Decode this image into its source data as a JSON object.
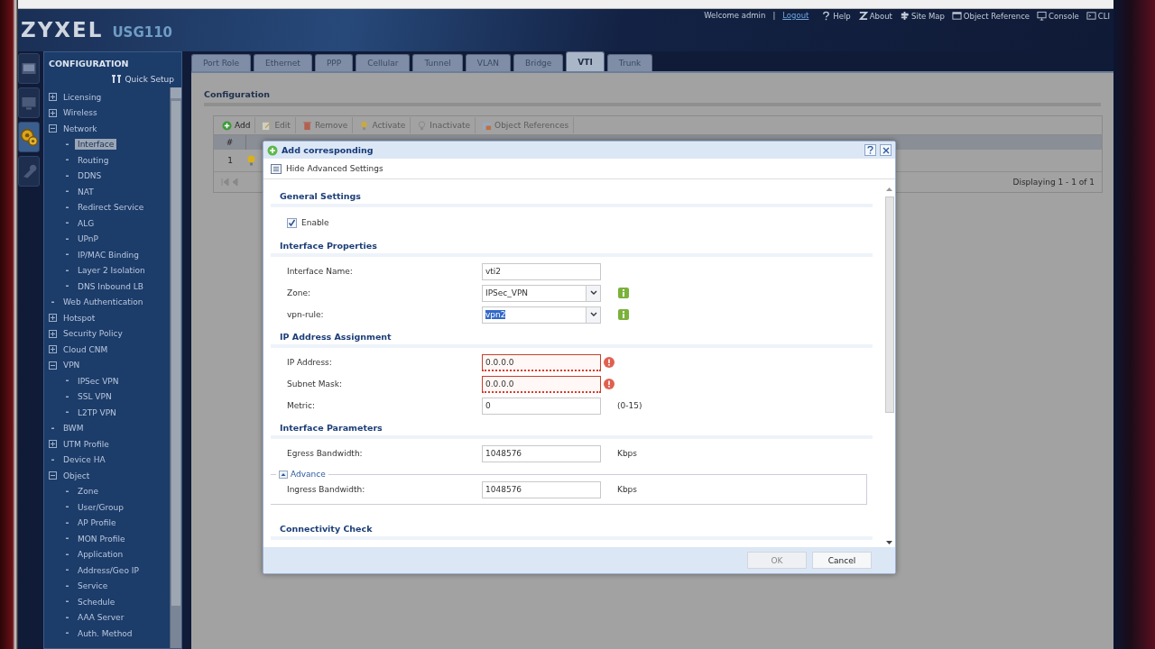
{
  "header": {
    "brand": "ZYXEL",
    "model": "USG110",
    "welcome": "Welcome admin",
    "separator": "|",
    "logout": "Logout",
    "links": [
      {
        "kind": "help",
        "label": "Help"
      },
      {
        "kind": "about",
        "label": "About"
      },
      {
        "kind": "sitemap",
        "label": "Site Map"
      },
      {
        "kind": "reference",
        "label": "Object Reference"
      },
      {
        "kind": "console",
        "label": "Console"
      },
      {
        "kind": "cli",
        "label": "CLI"
      }
    ]
  },
  "rail": [
    {
      "kind": "dashboard",
      "selected": false
    },
    {
      "kind": "monitor",
      "selected": false
    },
    {
      "kind": "configuration",
      "selected": true
    },
    {
      "kind": "maintenance",
      "selected": false
    }
  ],
  "sidebar": {
    "title": "CONFIGURATION",
    "quick_setup": "Quick Setup",
    "items": [
      {
        "label": "Licensing",
        "kind": "group",
        "expanded": false,
        "selected": false
      },
      {
        "label": "Wireless",
        "kind": "group",
        "expanded": false,
        "selected": false
      },
      {
        "label": "Network",
        "kind": "group",
        "expanded": true,
        "selected": false,
        "children": [
          {
            "label": "Interface",
            "kind": "leaf",
            "selected": true
          },
          {
            "label": "Routing",
            "kind": "leaf",
            "selected": false
          },
          {
            "label": "DDNS",
            "kind": "leaf",
            "selected": false
          },
          {
            "label": "NAT",
            "kind": "leaf",
            "selected": false
          },
          {
            "label": "Redirect Service",
            "kind": "leaf",
            "selected": false
          },
          {
            "label": "ALG",
            "kind": "leaf",
            "selected": false
          },
          {
            "label": "UPnP",
            "kind": "leaf",
            "selected": false
          },
          {
            "label": "IP/MAC Binding",
            "kind": "leaf",
            "selected": false
          },
          {
            "label": "Layer 2 Isolation",
            "kind": "leaf",
            "selected": false
          },
          {
            "label": "DNS Inbound LB",
            "kind": "leaf",
            "selected": false
          }
        ]
      },
      {
        "label": "Web Authentication",
        "kind": "leaf",
        "selected": false
      },
      {
        "label": "Hotspot",
        "kind": "group",
        "expanded": false,
        "selected": false
      },
      {
        "label": "Security Policy",
        "kind": "group",
        "expanded": false,
        "selected": false
      },
      {
        "label": "Cloud CNM",
        "kind": "group",
        "expanded": false,
        "selected": false
      },
      {
        "label": "VPN",
        "kind": "group",
        "expanded": true,
        "selected": false,
        "children": [
          {
            "label": "IPSec VPN",
            "kind": "leaf",
            "selected": false
          },
          {
            "label": "SSL VPN",
            "kind": "leaf",
            "selected": false
          },
          {
            "label": "L2TP VPN",
            "kind": "leaf",
            "selected": false
          }
        ]
      },
      {
        "label": "BWM",
        "kind": "leaf",
        "selected": false
      },
      {
        "label": "UTM Profile",
        "kind": "group",
        "expanded": false,
        "selected": false
      },
      {
        "label": "Device HA",
        "kind": "leaf",
        "selected": false
      },
      {
        "label": "Object",
        "kind": "group",
        "expanded": true,
        "selected": false,
        "children": [
          {
            "label": "Zone",
            "kind": "leaf",
            "selected": false
          },
          {
            "label": "User/Group",
            "kind": "leaf",
            "selected": false
          },
          {
            "label": "AP Profile",
            "kind": "leaf",
            "selected": false
          },
          {
            "label": "MON Profile",
            "kind": "leaf",
            "selected": false
          },
          {
            "label": "Application",
            "kind": "leaf",
            "selected": false
          },
          {
            "label": "Address/Geo IP",
            "kind": "leaf",
            "selected": false
          },
          {
            "label": "Service",
            "kind": "leaf",
            "selected": false
          },
          {
            "label": "Schedule",
            "kind": "leaf",
            "selected": false
          },
          {
            "label": "AAA Server",
            "kind": "leaf",
            "selected": false
          },
          {
            "label": "Auth. Method",
            "kind": "leaf",
            "selected": false
          }
        ]
      }
    ]
  },
  "tabs": [
    {
      "label": "Port Role",
      "selected": false
    },
    {
      "label": "Ethernet",
      "selected": false
    },
    {
      "label": "PPP",
      "selected": false
    },
    {
      "label": "Cellular",
      "selected": false
    },
    {
      "label": "Tunnel",
      "selected": false
    },
    {
      "label": "VLAN",
      "selected": false
    },
    {
      "label": "Bridge",
      "selected": false
    },
    {
      "label": "VTI",
      "selected": true
    },
    {
      "label": "Trunk",
      "selected": false
    }
  ],
  "panel": {
    "title": "Configuration",
    "toolbar": [
      {
        "kind": "add",
        "label": "Add",
        "disabled": false
      },
      {
        "kind": "edit",
        "label": "Edit",
        "disabled": true
      },
      {
        "kind": "remove",
        "label": "Remove",
        "disabled": true
      },
      {
        "kind": "activate",
        "label": "Activate",
        "disabled": true
      },
      {
        "kind": "inactivate",
        "label": "Inactivate",
        "disabled": true
      },
      {
        "kind": "references",
        "label": "Object References",
        "disabled": true
      }
    ],
    "table": {
      "columns": [
        "#"
      ],
      "rows": [
        {
          "cells": [
            "1"
          ],
          "active": true
        }
      ]
    },
    "pager": "Displaying 1 - 1 of 1"
  },
  "dialog": {
    "title": "Add corresponding",
    "toggle": "Hide Advanced Settings",
    "sections": [
      {
        "title": "General Settings",
        "rows": [
          {
            "kind": "checkbox",
            "label": "Enable",
            "checked": true
          }
        ]
      },
      {
        "title": "Interface Properties",
        "rows": [
          {
            "kind": "text",
            "label": "Interface Name:",
            "value": "vti2",
            "invalid": false
          },
          {
            "kind": "select",
            "label": "Zone:",
            "value": "IPSec_VPN",
            "info": true,
            "text_selected": false
          },
          {
            "kind": "select",
            "label": "vpn-rule:",
            "value": "vpn2",
            "info": true,
            "text_selected": true
          }
        ]
      },
      {
        "title": "IP Address Assignment",
        "rows": [
          {
            "kind": "text",
            "label": "IP Address:",
            "value": "0.0.0.0",
            "invalid": true
          },
          {
            "kind": "text",
            "label": "Subnet Mask:",
            "value": "0.0.0.0",
            "invalid": true
          },
          {
            "kind": "text",
            "label": "Metric:",
            "value": "0",
            "invalid": false,
            "suffix": "(0-15)"
          }
        ]
      },
      {
        "title": "Interface Parameters",
        "rows": [
          {
            "kind": "text",
            "label": "Egress Bandwidth:",
            "value": "1048576",
            "invalid": false,
            "suffix": "Kbps"
          }
        ],
        "advance": {
          "label": "Advance",
          "expanded": true,
          "rows": [
            {
              "kind": "text",
              "label": "Ingress Bandwidth:",
              "value": "1048576",
              "invalid": false,
              "suffix": "Kbps"
            }
          ]
        }
      },
      {
        "title": "Connectivity Check"
      }
    ],
    "buttons": [
      {
        "label": "OK",
        "disabled": true
      },
      {
        "label": "Cancel",
        "disabled": false
      }
    ]
  }
}
